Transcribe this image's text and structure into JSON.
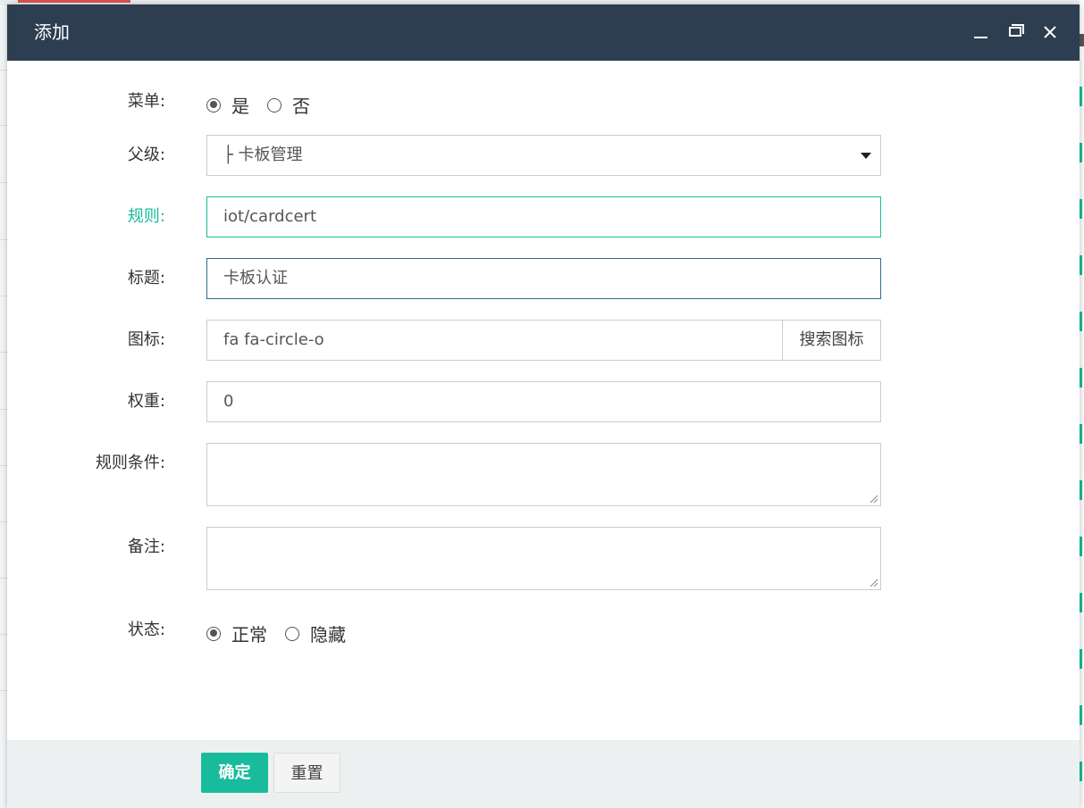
{
  "dialog": {
    "title": "添加",
    "controls": {
      "minimize": "minimize-icon",
      "maximize": "maximize-icon",
      "close": "close-icon"
    }
  },
  "form": {
    "menu": {
      "label": "菜单:",
      "options": [
        "是",
        "否"
      ],
      "selected": "是"
    },
    "parent": {
      "label": "父级:",
      "value": "├ 卡板管理"
    },
    "rule": {
      "label": "规则:",
      "value": "iot/cardcert"
    },
    "title": {
      "label": "标题:",
      "value": "卡板认证"
    },
    "icon": {
      "label": "图标:",
      "value": "fa fa-circle-o",
      "search_button": "搜索图标"
    },
    "weight": {
      "label": "权重:",
      "value": "0"
    },
    "condition": {
      "label": "规则条件:",
      "value": ""
    },
    "remark": {
      "label": "备注:",
      "value": ""
    },
    "status": {
      "label": "状态:",
      "options": [
        "正常",
        "隐藏"
      ],
      "selected": "正常"
    }
  },
  "footer": {
    "confirm_label": "确定",
    "reset_label": "重置"
  },
  "colors": {
    "header": "#2c3e50",
    "accent": "#18bc9c",
    "footer": "#ecf0f1"
  }
}
